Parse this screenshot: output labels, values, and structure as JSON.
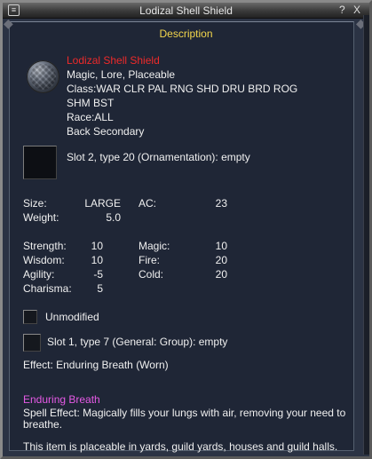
{
  "window": {
    "title": "Lodizal Shell Shield",
    "help_label": "?",
    "close_label": "X",
    "section_label": "Description"
  },
  "item": {
    "name": "Lodizal Shell Shield",
    "flags": "Magic, Lore, Placeable",
    "class_line1": "Class:WAR CLR PAL RNG SHD DRU BRD ROG",
    "class_line2": "SHM BST",
    "race": "Race:ALL",
    "slot": "Back Secondary"
  },
  "augment_slot": "Slot 2, type 20 (Ornamentation): empty",
  "stats": {
    "size_label": "Size:",
    "size_value": "LARGE",
    "weight_label": "Weight:",
    "weight_value": "5.0",
    "ac_label": "AC:",
    "ac_value": "23",
    "strength_label": "Strength:",
    "strength_value": "10",
    "wisdom_label": "Wisdom:",
    "wisdom_value": "10",
    "agility_label": "Agility:",
    "agility_value": "-5",
    "charisma_label": "Charisma:",
    "charisma_value": "5",
    "magic_label": "Magic:",
    "magic_value": "10",
    "fire_label": "Fire:",
    "fire_value": "20",
    "cold_label": "Cold:",
    "cold_value": "20"
  },
  "unmodified_label": "Unmodified",
  "evolve_slot": "Slot 1, type 7 (General: Group): empty",
  "effect_line": "Effect: Enduring Breath (Worn)",
  "spell": {
    "name": "Enduring Breath",
    "effect_line1": "Spell Effect: Magically fills your lungs with air, removing your need to",
    "effect_line2": "breathe."
  },
  "placeable_note": "This item is placeable in yards, guild yards, houses and guild halls.",
  "colors": {
    "item_name": "#ee2a2a",
    "spell_name": "#e65ae6",
    "section_label": "#f3d64c"
  },
  "icons": {
    "item_icon": "shield-icon",
    "title_button": "minimize-icon"
  }
}
